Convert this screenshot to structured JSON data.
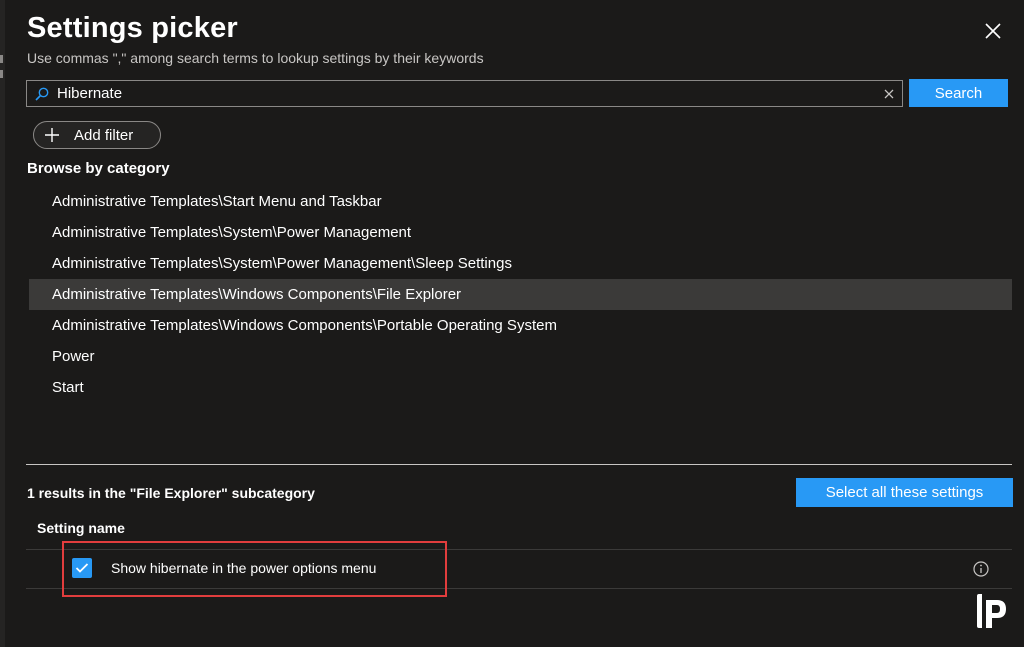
{
  "header": {
    "title": "Settings picker",
    "subtitle": "Use commas \",\" among search terms to lookup settings by their keywords",
    "close_icon": "close-icon"
  },
  "search": {
    "value": "Hibernate",
    "search_icon": "search-icon",
    "clear_icon": "clear-icon",
    "button_label": "Search"
  },
  "filter": {
    "add_filter_label": "Add filter",
    "icon": "plus-icon"
  },
  "browse": {
    "heading": "Browse by category",
    "selected_index": 3,
    "categories": [
      {
        "label": "Administrative Templates\\Start Menu and Taskbar"
      },
      {
        "label": "Administrative Templates\\System\\Power Management"
      },
      {
        "label": "Administrative Templates\\System\\Power Management\\Sleep Settings"
      },
      {
        "label": "Administrative Templates\\Windows Components\\File Explorer"
      },
      {
        "label": "Administrative Templates\\Windows Components\\Portable Operating System"
      },
      {
        "label": "Power"
      },
      {
        "label": "Start"
      }
    ]
  },
  "results": {
    "summary": "1 results in the \"File Explorer\" subcategory",
    "select_all_label": "Select all these settings",
    "column_header": "Setting name",
    "rows": [
      {
        "name": "Show hibernate in the power options menu",
        "checked": true,
        "info_icon": "info-icon"
      }
    ]
  },
  "colors": {
    "accent": "#2899f5",
    "background": "#1b1a19",
    "selected_row": "#3b3a39",
    "highlight_border": "#e23d3d"
  }
}
